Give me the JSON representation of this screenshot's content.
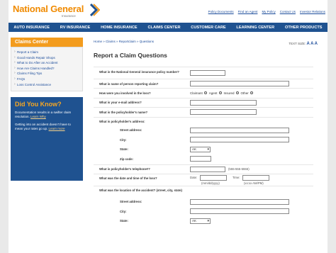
{
  "header": {
    "logo_text": "National General",
    "logo_sub": "Insurance",
    "links": [
      "Policy Documents",
      "Find an Agent",
      "My Policy",
      "Contact Us",
      "Investor Relations"
    ]
  },
  "nav": [
    "AUTO INSURANCE",
    "RV INSURANCE",
    "HOME INSURANCE",
    "CLAIMS CENTER",
    "CUSTOMER CARE",
    "LEARNING CENTER",
    "OTHER PRODUCTS"
  ],
  "sidebar": {
    "title": "Claims Center",
    "items": [
      "Report a Claim",
      "Good Hands Repair Shops",
      "What to Do After an Accident",
      "How Are Claims Handled?",
      "Claims Filing Tips",
      "FAQs",
      "Loss Control Assistance"
    ],
    "dyk_title": "Did You Know?",
    "dyk_text1": "Documentation results in a swifter claim resolution.",
    "dyk_link1": "Learn Why",
    "dyk_text2": "Getting into an accident doesn't have to mean your rates go up.",
    "dyk_link2": "Learn more"
  },
  "main": {
    "breadcrumb": "Home » Claims » Reportclaim » Questions",
    "text_size_label": "TEXT SIZE:",
    "text_size_options": "A A A",
    "title": "Report a Claim Questions",
    "q_policy": "What is the National General insurance policy number?",
    "q_name": "What is name of person reporting claim?",
    "q_involved": "How were you involved in the loss?",
    "radio_options": [
      "Claimant",
      "Agent",
      "Insured",
      "Other"
    ],
    "q_email": "What is your e-mail address?",
    "q_policyholder_name": "What is the policyholder's name?",
    "q_policyholder_address": "What is policyholder's address:",
    "street_label": "Street address:",
    "city_label": "City:",
    "state_label": "State:",
    "state_value": "AK",
    "zip_label": "Zip code:",
    "q_phone": "What is policyholder's telephone#?",
    "phone_hint": "(555-555-5555)",
    "q_datetime": "What was the date and time of the loss?",
    "date_label": "Date:",
    "time_label": "Time:",
    "date_hint": "(mm/dd/yyyy)",
    "time_hint": "(xx:xx AM/PM)",
    "q_location": "What was the location of the accident? (street, city, state)",
    "street2_label": "Street address:",
    "city2_label": "City:",
    "state2_label": "State:",
    "state2_value": "AK"
  },
  "colors": {
    "nav_blue": "#1f5290",
    "accent_orange": "#f39c1e",
    "link_blue": "#1a4b9a"
  }
}
